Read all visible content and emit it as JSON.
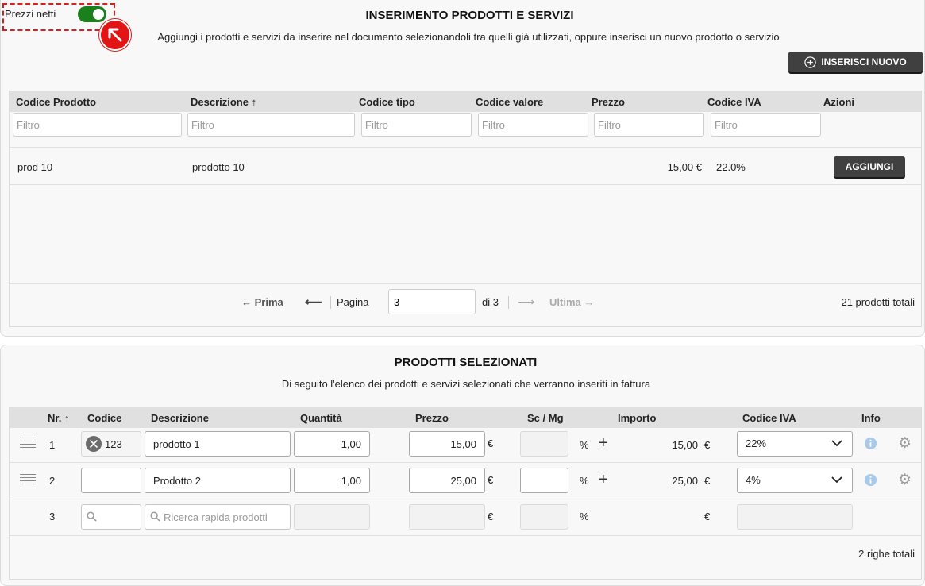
{
  "toggle": {
    "label": "Prezzi netti",
    "state": "on"
  },
  "insert_section": {
    "title": "INSERIMENTO PRODOTTI E SERVIZI",
    "subtitle": "Aggiungi i prodotti e servizi da inserire nel documento selezionandoli tra quelli già utilizzati, oppure inserisci un nuovo prodotto o servizio",
    "new_button": "INSERISCI NUOVO",
    "columns": [
      "Codice Prodotto",
      "Descrizione",
      "Codice tipo",
      "Codice valore",
      "Prezzo",
      "Codice IVA",
      "Azioni"
    ],
    "sort_arrow": "↑",
    "filter_placeholder": "Filtro",
    "rows": [
      {
        "codice": "prod 10",
        "descrizione": "prodotto 10",
        "codice_tipo": "",
        "codice_valore": "",
        "prezzo": "15,00 €",
        "iva": "22.0%",
        "action": "AGGIUNGI"
      }
    ],
    "pagination": {
      "first": "Prima",
      "page_label": "Pagina",
      "page_value": "3",
      "of_label": "di 3",
      "last": "Ultima",
      "total": "21 prodotti totali"
    }
  },
  "selected_section": {
    "title": "PRODOTTI SELEZIONATI",
    "subtitle": "Di seguito l'elenco dei prodotti e servizi selezionati che verranno inseriti in fattura",
    "columns": [
      "Nr.",
      "Codice",
      "Descrizione",
      "Quantità",
      "Prezzo",
      "Sc / Mg",
      "Importo",
      "Codice IVA",
      "Info"
    ],
    "sort_arrow": "↑",
    "rows": [
      {
        "nr": "1",
        "codice": "123",
        "descrizione": "prodotto 1",
        "quantita": "1,00",
        "prezzo": "15,00",
        "euro": "€",
        "sconto": "",
        "percent": "%",
        "importo": "15,00",
        "importo_euro": "€",
        "iva": "22%"
      },
      {
        "nr": "2",
        "codice": "",
        "descrizione": "Prodotto 2",
        "quantita": "1,00",
        "prezzo": "25,00",
        "euro": "€",
        "sconto": "",
        "percent": "%",
        "importo": "25,00",
        "importo_euro": "€",
        "iva": "4%"
      }
    ],
    "new_row": {
      "nr": "3",
      "search_placeholder": "Ricerca rapida prodotti",
      "euro": "€",
      "percent": "%",
      "importo_euro": "€"
    },
    "total": "2 righe totali"
  },
  "colors": {
    "toggle_on": "#1b7f1b",
    "dark_button": "#404040",
    "highlight": "#e31414",
    "info_icon": "#a9c9ea"
  }
}
